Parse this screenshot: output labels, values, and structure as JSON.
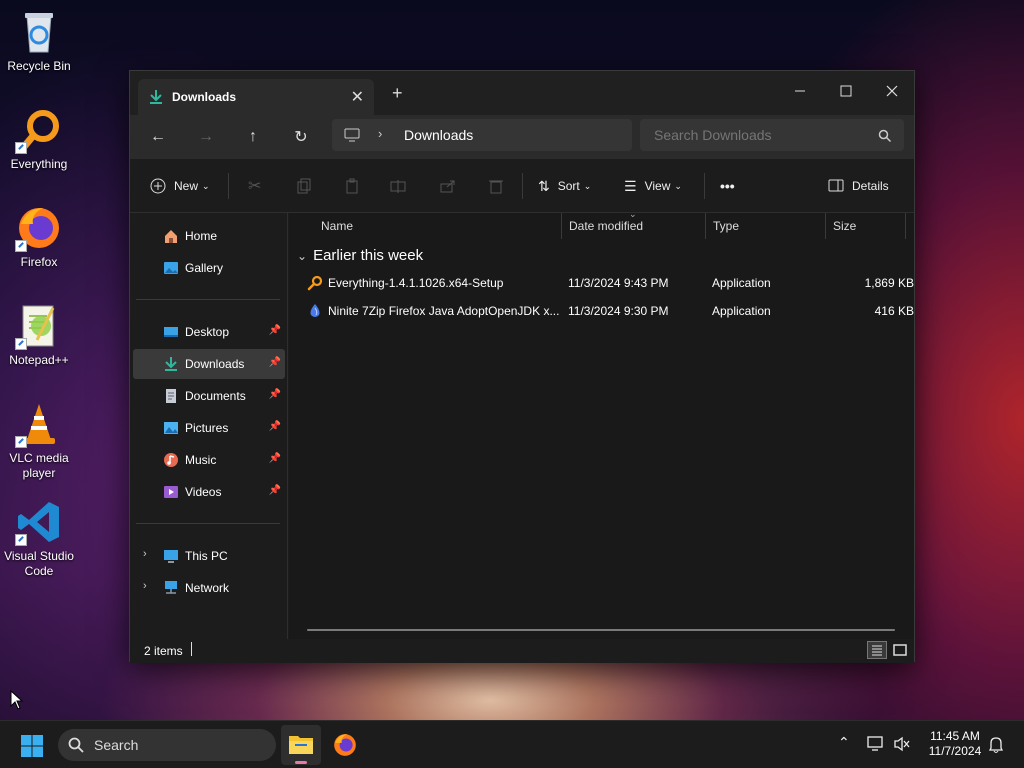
{
  "desktop": {
    "icons": [
      {
        "label": "Recycle Bin"
      },
      {
        "label": "Everything"
      },
      {
        "label": "Firefox"
      },
      {
        "label": "Notepad++"
      },
      {
        "label": "VLC media player"
      },
      {
        "label": "Visual Studio Code"
      }
    ]
  },
  "explorer": {
    "tab_title": "Downloads",
    "new_tab_label": "+",
    "address": {
      "location": "Downloads"
    },
    "search": {
      "placeholder": "Search Downloads"
    },
    "toolbar": {
      "new_label": "New",
      "sort_label": "Sort",
      "view_label": "View",
      "more_label": "•••",
      "details_label": "Details"
    },
    "sidebar": {
      "home": "Home",
      "gallery": "Gallery",
      "desktop": "Desktop",
      "downloads": "Downloads",
      "documents": "Documents",
      "pictures": "Pictures",
      "music": "Music",
      "videos": "Videos",
      "this_pc": "This PC",
      "network": "Network"
    },
    "columns": {
      "name": "Name",
      "date_modified": "Date modified",
      "type": "Type",
      "size": "Size"
    },
    "group_label": "Earlier this week",
    "files": [
      {
        "name": "Everything-1.4.1.1026.x64-Setup",
        "date": "11/3/2024 9:43 PM",
        "type": "Application",
        "size": "1,869 KB"
      },
      {
        "name": "Ninite 7Zip Firefox Java AdoptOpenJDK x...",
        "date": "11/3/2024 9:30 PM",
        "type": "Application",
        "size": "416 KB"
      }
    ],
    "status": {
      "item_count": "2 items"
    }
  },
  "taskbar": {
    "search_placeholder": "Search",
    "time": "11:45 AM",
    "date": "11/7/2024"
  },
  "colors": {
    "accent": "#2a9d8f",
    "window_bg": "#1c1c1c",
    "selected": "#3a3a3a"
  }
}
